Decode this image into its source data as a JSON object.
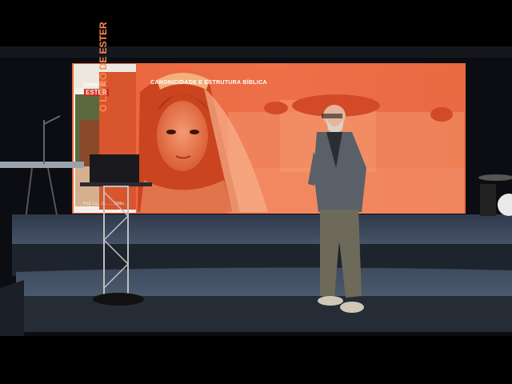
{
  "slide": {
    "title": "CANONICIDADE E ESTRUTURA BÍBLICA",
    "book_cover_top": "LIVRO DE",
    "book_cover_name": "ESTER",
    "book_spine": "O LIVRO DE ESTER",
    "author": "Prof. Lu... C... ..., DMin."
  },
  "colors": {
    "screen_orange": "#e8653e",
    "stage_blue": "#3d4a5c",
    "background": "#0b0b0e"
  }
}
